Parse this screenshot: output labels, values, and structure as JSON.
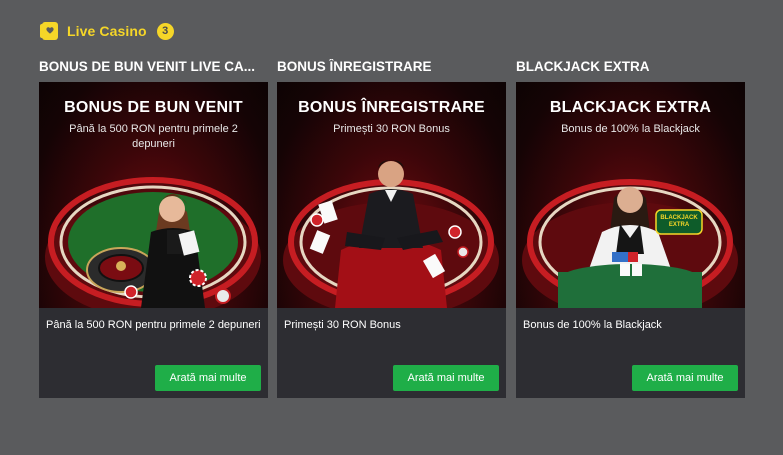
{
  "section": {
    "title": "Live Casino",
    "count": "3",
    "icon": "cards-icon"
  },
  "promos": [
    {
      "heading": "BONUS DE BUN VENIT LIVE CA...",
      "banner_title": "BONUS DE BUN VENIT",
      "banner_subtitle": "Până la 500 RON pentru primele 2 depuneri",
      "description": "Până la 500 RON pentru primele 2 depuneri",
      "cta": "Arată mai multe"
    },
    {
      "heading": "BONUS ÎNREGISTRARE",
      "banner_title": "BONUS ÎNREGISTRARE",
      "banner_subtitle": "Primești 30 RON Bonus",
      "description": "Primești 30 RON Bonus",
      "cta": "Arată mai multe"
    },
    {
      "heading": "BLACKJACK EXTRA",
      "banner_title": "BLACKJACK EXTRA",
      "banner_subtitle": "Bonus de 100% la Blackjack",
      "description": "Bonus de 100% la Blackjack",
      "cta": "Arată mai multe",
      "banner_logo": "BLACKJACK EXTRA"
    }
  ],
  "colors": {
    "accent": "#f5d628",
    "cta": "#1fae48",
    "card": "#2d2d32",
    "page": "#5a5b5d"
  }
}
